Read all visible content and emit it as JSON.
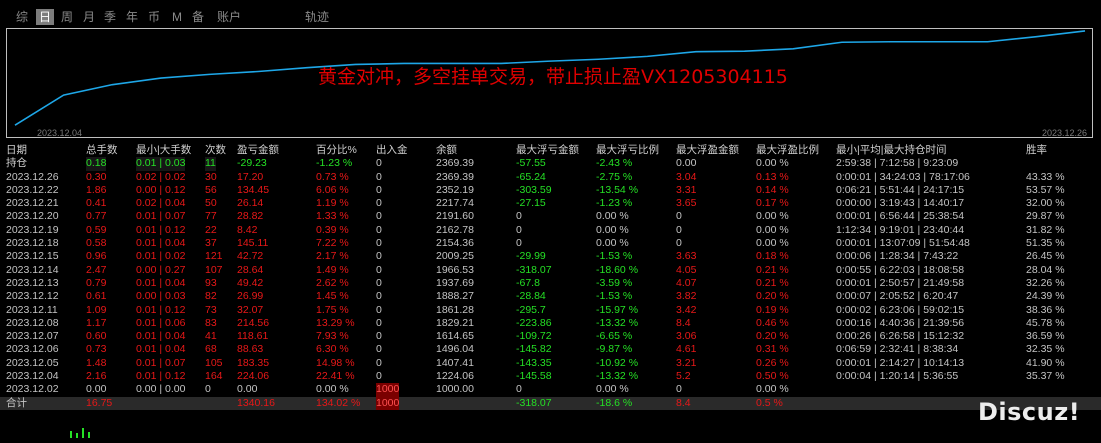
{
  "tabs": [
    "综",
    "日",
    "周",
    "月",
    "季",
    "年",
    "币",
    "M",
    "备",
    "账户",
    "轨迹"
  ],
  "active_tab": "日",
  "chart": {
    "note": "黄金对冲，多空挂单交易，带止损止盈VX1205304115",
    "start_date": "2023.12.04",
    "end_date": "2023.12.26",
    "equity": [
      0,
      0.32,
      0.43,
      0.5,
      0.54,
      0.57,
      0.61,
      0.645,
      0.655,
      0.655,
      0.655,
      0.68,
      0.7,
      0.73,
      0.78,
      0.785,
      0.81,
      0.88,
      0.885,
      0.885,
      0.885,
      0.94,
      1.0
    ]
  },
  "headers": [
    "日期",
    "总手数",
    "最小|大手数",
    "次数",
    "盈亏金额",
    "百分比%",
    "出入金",
    "余额",
    "最大浮亏金额",
    "最大浮亏比例",
    "最大浮盈金额",
    "最大浮盈比例",
    "最小|平均|最大持仓时间",
    "胜率"
  ],
  "rows": [
    {
      "kind": "hold",
      "cells": [
        "持仓",
        "0.18",
        "0.01 | 0.03",
        "11",
        "-29.23",
        "-1.23 %",
        "0",
        "2369.39",
        "-57.55",
        "-2.43 %",
        "0.00",
        "0.00 %",
        "2:59:38 | 7:12:58 | 9:23:09",
        ""
      ]
    },
    {
      "kind": "day",
      "cells": [
        "2023.12.26",
        "0.30",
        "0.02 | 0.02",
        "30",
        "17.20",
        "0.73 %",
        "0",
        "2369.39",
        "-65.24",
        "-2.75 %",
        "3.04",
        "0.13 %",
        "0:00:01 | 34:24:03 | 78:17:06",
        "43.33 %"
      ]
    },
    {
      "kind": "day",
      "cells": [
        "2023.12.22",
        "1.86",
        "0.00 | 0.12",
        "56",
        "134.45",
        "6.06 %",
        "0",
        "2352.19",
        "-303.59",
        "-13.54 %",
        "3.31",
        "0.14 %",
        "0:06:21 | 5:51:44 | 24:17:15",
        "53.57 %"
      ]
    },
    {
      "kind": "day",
      "cells": [
        "2023.12.21",
        "0.41",
        "0.02 | 0.04",
        "50",
        "26.14",
        "1.19 %",
        "0",
        "2217.74",
        "-27.15",
        "-1.23 %",
        "3.65",
        "0.17 %",
        "0:00:00 | 3:19:43 | 14:40:17",
        "32.00 %"
      ]
    },
    {
      "kind": "day",
      "cells": [
        "2023.12.20",
        "0.77",
        "0.01 | 0.07",
        "77",
        "28.82",
        "1.33 %",
        "0",
        "2191.60",
        "0",
        "0.00 %",
        "0",
        "0.00 %",
        "0:00:01 | 6:56:44 | 25:38:54",
        "29.87 %"
      ]
    },
    {
      "kind": "day",
      "cells": [
        "2023.12.19",
        "0.59",
        "0.01 | 0.12",
        "22",
        "8.42",
        "0.39 %",
        "0",
        "2162.78",
        "0",
        "0.00 %",
        "0",
        "0.00 %",
        "1:12:34 | 9:19:01 | 23:40:44",
        "31.82 %"
      ]
    },
    {
      "kind": "day",
      "cells": [
        "2023.12.18",
        "0.58",
        "0.01 | 0.04",
        "37",
        "145.11",
        "7.22 %",
        "0",
        "2154.36",
        "0",
        "0.00 %",
        "0",
        "0.00 %",
        "0:00:01 | 13:07:09 | 51:54:48",
        "51.35 %"
      ]
    },
    {
      "kind": "day",
      "cells": [
        "2023.12.15",
        "0.96",
        "0.01 | 0.02",
        "121",
        "42.72",
        "2.17 %",
        "0",
        "2009.25",
        "-29.99",
        "-1.53 %",
        "3.63",
        "0.18 %",
        "0:00:06 | 1:28:34 | 7:43:22",
        "26.45 %"
      ]
    },
    {
      "kind": "day",
      "cells": [
        "2023.12.14",
        "2.47",
        "0.00 | 0.27",
        "107",
        "28.64",
        "1.49 %",
        "0",
        "1966.53",
        "-318.07",
        "-18.60 %",
        "4.05",
        "0.21 %",
        "0:00:55 | 6:22:03 | 18:08:58",
        "28.04 %"
      ]
    },
    {
      "kind": "day",
      "cells": [
        "2023.12.13",
        "0.79",
        "0.01 | 0.04",
        "93",
        "49.42",
        "2.62 %",
        "0",
        "1937.69",
        "-67.8",
        "-3.59 %",
        "4.07",
        "0.21 %",
        "0:00:01 | 2:50:57 | 21:49:58",
        "32.26 %"
      ]
    },
    {
      "kind": "day",
      "cells": [
        "2023.12.12",
        "0.61",
        "0.00 | 0.03",
        "82",
        "26.99",
        "1.45 %",
        "0",
        "1888.27",
        "-28.84",
        "-1.53 %",
        "3.82",
        "0.20 %",
        "0:00:07 | 2:05:52 | 6:20:47",
        "24.39 %"
      ]
    },
    {
      "kind": "day",
      "cells": [
        "2023.12.11",
        "1.09",
        "0.01 | 0.12",
        "73",
        "32.07",
        "1.75 %",
        "0",
        "1861.28",
        "-295.7",
        "-15.97 %",
        "3.42",
        "0.19 %",
        "0:00:02 | 6:23:06 | 59:02:15",
        "38.36 %"
      ]
    },
    {
      "kind": "day",
      "cells": [
        "2023.12.08",
        "1.17",
        "0.01 | 0.06",
        "83",
        "214.56",
        "13.29 %",
        "0",
        "1829.21",
        "-223.86",
        "-13.32 %",
        "8.4",
        "0.46 %",
        "0:00:16 | 4:40:36 | 21:39:56",
        "45.78 %"
      ]
    },
    {
      "kind": "day",
      "cells": [
        "2023.12.07",
        "0.60",
        "0.01 | 0.04",
        "41",
        "118.61",
        "7.93 %",
        "0",
        "1614.65",
        "-109.72",
        "-6.65 %",
        "3.06",
        "0.20 %",
        "0:00:26 | 6:26:58 | 15:12:32",
        "36.59 %"
      ]
    },
    {
      "kind": "day",
      "cells": [
        "2023.12.06",
        "0.73",
        "0.01 | 0.04",
        "68",
        "88.63",
        "6.30 %",
        "0",
        "1496.04",
        "-145.82",
        "-9.87 %",
        "4.61",
        "0.31 %",
        "0:06:59 | 2:32:41 | 8:38:34",
        "32.35 %"
      ]
    },
    {
      "kind": "day",
      "cells": [
        "2023.12.05",
        "1.48",
        "0.01 | 0.07",
        "105",
        "183.35",
        "14.98 %",
        "0",
        "1407.41",
        "-143.35",
        "-10.92 %",
        "3.21",
        "0.26 %",
        "0:00:01 | 2:14:27 | 10:14:13",
        "41.90 %"
      ]
    },
    {
      "kind": "day",
      "cells": [
        "2023.12.04",
        "2.16",
        "0.01 | 0.12",
        "164",
        "224.06",
        "22.41 %",
        "0",
        "1224.06",
        "-145.58",
        "-13.32 %",
        "5.2",
        "0.50 %",
        "0:00:04 | 1:20:14 | 5:36:55",
        "35.37 %"
      ]
    },
    {
      "kind": "zero",
      "cells": [
        "2023.12.02",
        "0.00",
        "0.00 | 0.00",
        "0",
        "0.00",
        "0.00 %",
        "1000",
        "1000.00",
        "0",
        "0.00 %",
        "0",
        "0.00 %",
        "",
        ""
      ]
    },
    {
      "kind": "total",
      "cells": [
        "合计",
        "16.75",
        "",
        "",
        "1340.16",
        "134.02 %",
        "1000",
        "",
        "-318.07",
        "-18.6 %",
        "8.4",
        "0.5 %",
        "",
        ""
      ]
    }
  ],
  "colors": {
    "red": "#e81818",
    "green": "#25e025",
    "gray": "#c4c4c4",
    "line": "#1ea7e8"
  },
  "watermark": "Discuz!"
}
